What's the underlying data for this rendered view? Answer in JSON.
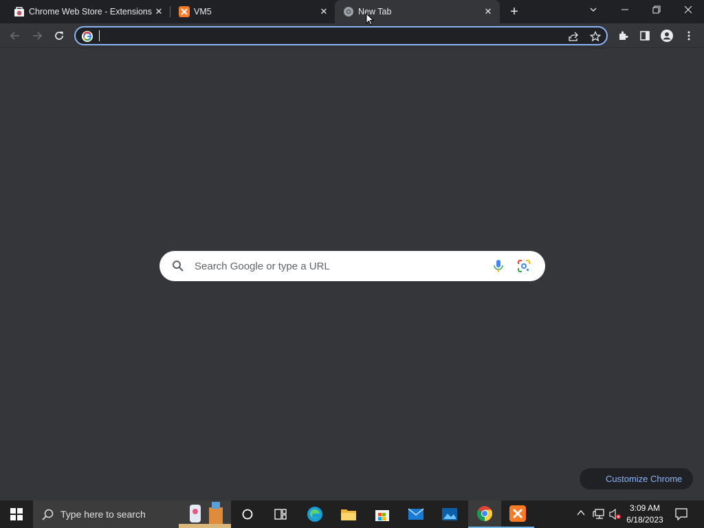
{
  "tabs": [
    {
      "title": "Chrome Web Store - Extensions",
      "icon": "chrome-web-store-icon",
      "active": false
    },
    {
      "title": "VM5",
      "icon": "xampp-icon",
      "active": false
    },
    {
      "title": "New Tab",
      "icon": "chrome-icon",
      "active": true
    }
  ],
  "omnibox": {
    "value": "",
    "placeholder": ""
  },
  "search": {
    "placeholder": "Search Google or type a URL"
  },
  "customize": {
    "label": "Customize Chrome"
  },
  "taskbar": {
    "search_placeholder": "Type here to search",
    "time": "3:09 AM",
    "date": "6/18/2023"
  },
  "colors": {
    "accent": "#8ab4f8",
    "background": "#35363a",
    "tabstrip": "#202124"
  }
}
